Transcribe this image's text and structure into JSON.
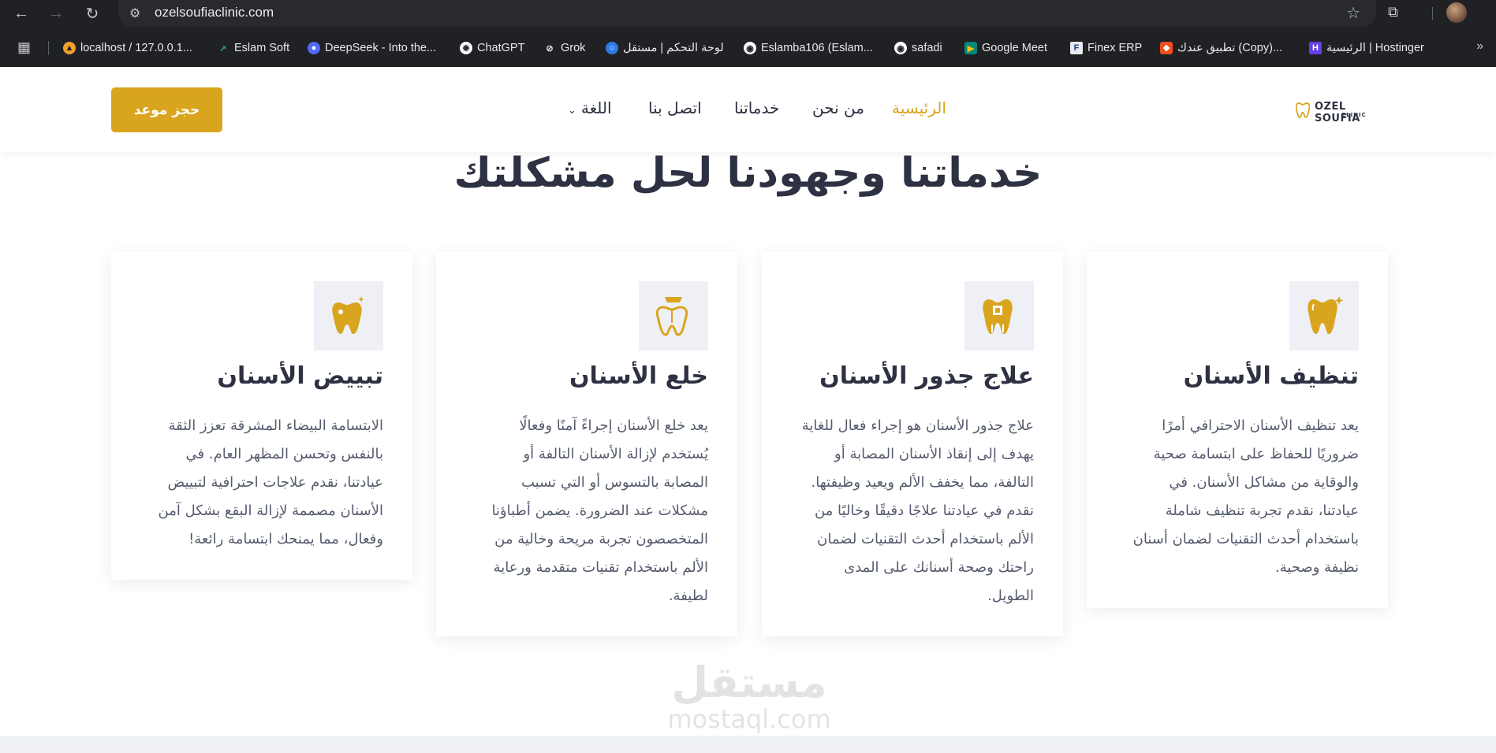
{
  "browser": {
    "url": "ozelsoufiaclinic.com",
    "bookmarks": [
      {
        "label": "localhost / 127.0.0.1...",
        "icon": "phpmyadmin-icon"
      },
      {
        "label": "Eslam Soft",
        "icon": "chart-icon"
      },
      {
        "label": "DeepSeek - Into the...",
        "icon": "deepseek-icon"
      },
      {
        "label": "ChatGPT",
        "icon": "chatgpt-icon"
      },
      {
        "label": "Grok",
        "icon": "grok-icon"
      },
      {
        "label": "لوحة التحكم | مستقل",
        "icon": "mostaql-icon"
      },
      {
        "label": "Eslamba106 (Eslam...",
        "icon": "github-icon"
      },
      {
        "label": "safadi",
        "icon": "github-icon"
      },
      {
        "label": "Google Meet",
        "icon": "meet-icon"
      },
      {
        "label": "Finex ERP",
        "icon": "finex-icon"
      },
      {
        "label": "تطبيق عندك (Copy)...",
        "icon": "figma-icon"
      },
      {
        "label": "الرئيسية | Hostinger",
        "icon": "hostinger-icon"
      }
    ]
  },
  "header": {
    "book_button": "حجز موعد",
    "nav": {
      "home": "الرئيسية",
      "about": "من نحن",
      "services": "خدماتنا",
      "contact": "اتصل بنا",
      "language": "اللغة"
    },
    "logo_line1": "OZEL SOUFIA",
    "logo_line2": "CLINIC"
  },
  "section": {
    "title": "خدماتنا وجهودنا لحل مشكلتك"
  },
  "cards": [
    {
      "title": "تنظيف الأسنان",
      "icon": "sparkle-tooth-icon",
      "lines": [
        "يعد تنظيف الأسنان الاحترافي أمرًا",
        "ضروريًا للحفاظ على ابتسامة صحية",
        "والوقاية من مشاكل الأسنان. في",
        "عيادتنا، نقدم تجربة تنظيف شاملة",
        "باستخدام أحدث التقنيات لضمان أسنان",
        "نظيفة وصحية."
      ]
    },
    {
      "title": "علاج جذور الأسنان",
      "icon": "root-canal-tooth-icon",
      "lines": [
        "علاج جذور الأسنان هو إجراء فعال للغاية",
        "يهدف إلى إنقاذ الأسنان المصابة أو",
        "التالفة، مما يخفف الألم ويعيد وظيفتها.",
        "نقدم في عيادتنا علاجًا دقيقًا وخاليًا من",
        "الألم باستخدام أحدث التقنيات لضمان",
        "راحتك وصحة أسنانك على المدى",
        "الطويل."
      ]
    },
    {
      "title": "خلع الأسنان",
      "icon": "extraction-tooth-icon",
      "lines": [
        "يعد خلع الأسنان إجراءً آمنًا وفعالًا",
        "يُستخدم لإزالة الأسنان التالفة أو",
        "المصابة بالتسوس أو التي تسبب",
        "مشكلات عند الضرورة. يضمن أطباؤنا",
        "المتخصصون تجربة مريحة وخالية من",
        "الألم باستخدام تقنيات متقدمة ورعاية",
        "لطيفة."
      ]
    },
    {
      "title": "تبييض الأسنان",
      "icon": "whitening-tooth-icon",
      "lines": [
        "الابتسامة البيضاء المشرقة تعزز الثقة",
        "بالنفس وتحسن المظهر العام. في",
        "عيادتنا، نقدم علاجات احترافية لتبييض",
        "الأسنان مصممة لإزالة البقع بشكل آمن",
        "وفعال، مما يمنحك ابتسامة رائعة!"
      ]
    }
  ],
  "watermark": {
    "ar": "مستقل",
    "en": "mostaql.com"
  },
  "colors": {
    "accent": "#d9a51e",
    "heading": "#2d3142",
    "body_text": "#555b6e",
    "icon_bg": "#eef0f5",
    "browser_bg": "#202124"
  }
}
